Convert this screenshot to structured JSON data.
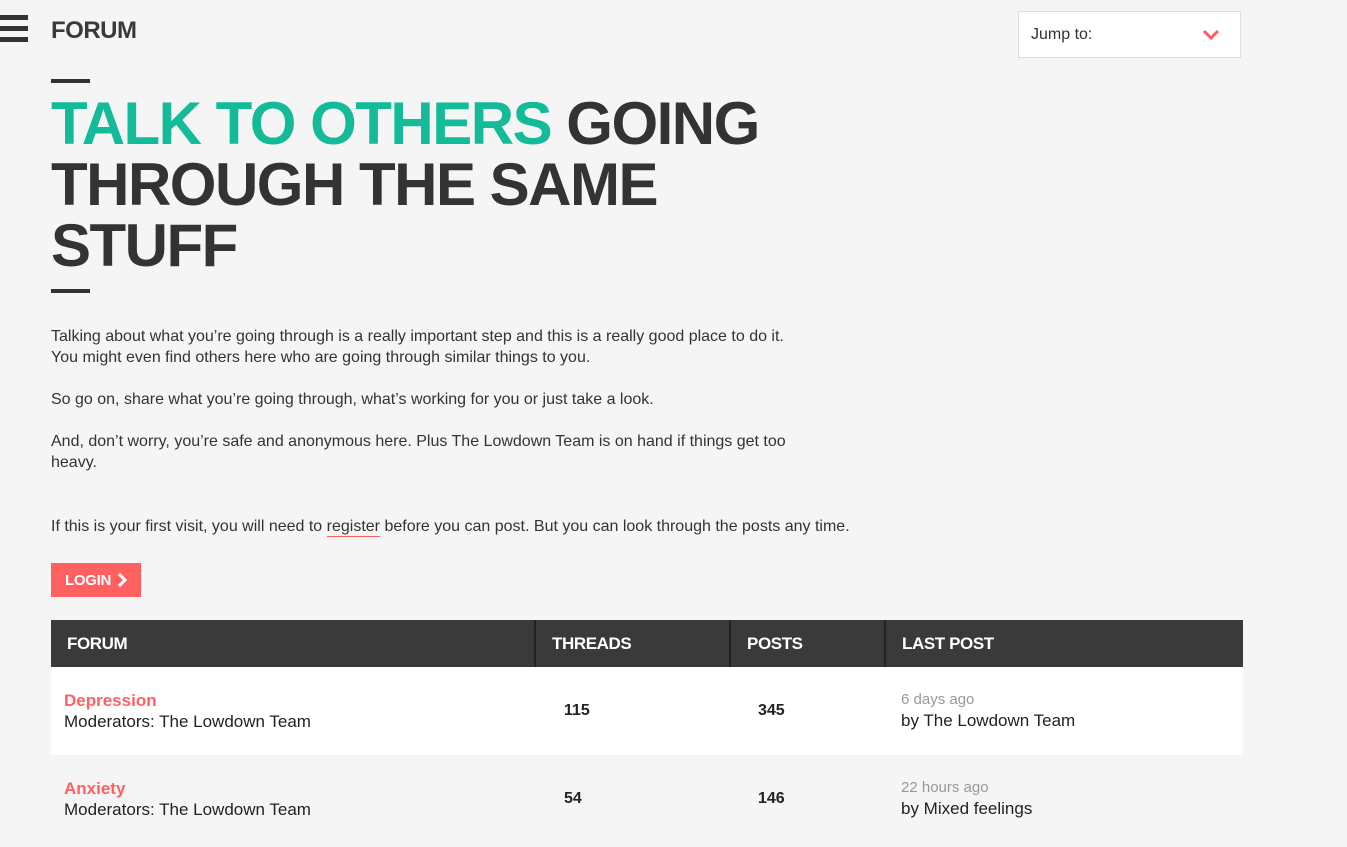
{
  "header": {
    "title": "FORUM",
    "jump_label": "Jump to:"
  },
  "hero": {
    "accent": "TALK TO OTHERS",
    "rest": " GOING THROUGH THE SAME STUFF"
  },
  "intro": {
    "p1_line1": "Talking about what you’re going through is a really important step and this is a really good place to do it.",
    "p1_line2": "You might even find others here who are going through similar things to you.",
    "p2": "So go on, share what you’re going through, what’s working for you or just take a look.",
    "p3_line1": "And, don’t worry, you’re safe and anonymous here. Plus The Lowdown Team is on hand if things get too",
    "p3_line2": "heavy."
  },
  "register": {
    "before": "If this is your first visit, you will need to ",
    "link": "register",
    "after": " before you can post. But you can look through the posts any time."
  },
  "login_label": "LOGIN",
  "table": {
    "headers": [
      "FORUM",
      "THREADS",
      "POSTS",
      "LAST POST"
    ],
    "rows": [
      {
        "name": "Depression",
        "moderators": "Moderators: The Lowdown Team",
        "threads": "115",
        "posts": "345",
        "last_time": "6 days ago",
        "last_by": "by The Lowdown Team"
      },
      {
        "name": "Anxiety",
        "moderators": "Moderators: The Lowdown Team",
        "threads": "54",
        "posts": "146",
        "last_time": "22 hours ago",
        "last_by": "by Mixed feelings"
      }
    ]
  },
  "colors": {
    "accent": "#13bb98",
    "brand_red": "#ff6060",
    "table_header": "#3a3a3a"
  }
}
